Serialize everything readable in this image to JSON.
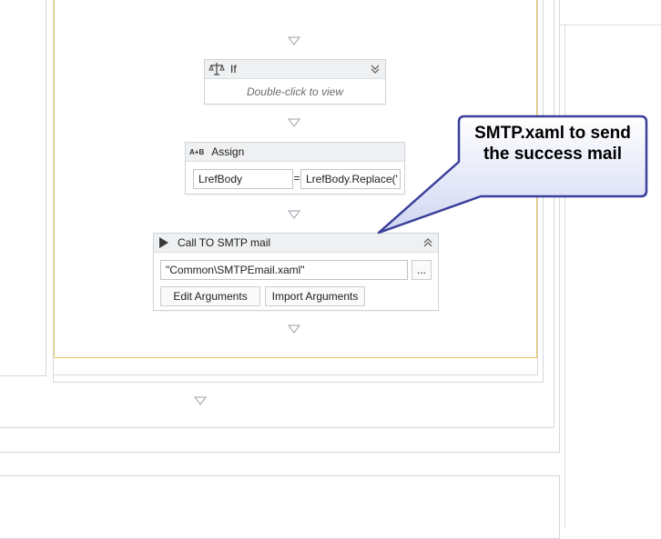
{
  "if_activity": {
    "title": "If",
    "hint": "Double-click to view",
    "icon": "balance-scale-icon"
  },
  "assign_activity": {
    "title": "Assign",
    "icon_text": "A+B",
    "to_value": "LrefBody",
    "operator": "=",
    "value": "LrefBody.Replace('"
  },
  "invoke_activity": {
    "title": "Call TO SMTP mail",
    "file_path": "\"Common\\SMTPEmail.xaml\"",
    "browse_label": "...",
    "edit_args_label": "Edit Arguments",
    "import_args_label": "Import Arguments",
    "icon": "play-icon"
  },
  "callout": {
    "text": "SMTP.xaml to send the success mail"
  },
  "colors": {
    "sequence_border": "#e8c55a",
    "frame_border": "#d4d7dc",
    "card_header": "#eef0f2",
    "callout_fill_top": "#ffffff",
    "callout_fill_bottom": "#cfd6f2",
    "callout_border": "#3a3f9a"
  }
}
